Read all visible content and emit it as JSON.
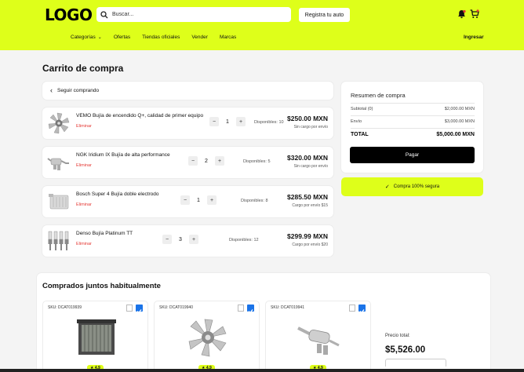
{
  "header": {
    "logo": "LOGO",
    "search_placeholder": "Buscar...",
    "register_label": "Registra tu auto",
    "login_label": "Ingresar",
    "nav": [
      "Categorías",
      "Ofertas",
      "Tiendas oficiales",
      "Vender",
      "Marcas"
    ],
    "accent": "#deff1a"
  },
  "cart": {
    "title": "Carrito de compra",
    "back_label": "Seguir comprando",
    "remove_label": "Eliminar",
    "items": [
      {
        "name": "VEMO Bujía de encendido Q+, calidad de primer equipo",
        "qty": "1",
        "stock": "Disponibles: 10",
        "price": "$250.00 MXN",
        "shipping": "Sin cargo por envío",
        "icon": "fan-part-icon"
      },
      {
        "name": "NGK Iridium IX Bujía de alta performance",
        "qty": "2",
        "stock": "Disponibles: 5",
        "price": "$320.00 MXN",
        "shipping": "Sin cargo por envío",
        "icon": "exhaust-part-icon"
      },
      {
        "name": "Bosch Super 4 Bujía doble electrodo",
        "qty": "1",
        "stock": "Disponibles: 8",
        "price": "$285.50 MXN",
        "shipping": "Cargo por envío $15",
        "icon": "radiator-part-icon"
      },
      {
        "name": "Denso Bujía Platinum TT",
        "qty": "3",
        "stock": "Disponibles: 12",
        "price": "$299.99 MXN",
        "shipping": "Cargo por envío $20",
        "icon": "spark-plugs-icon"
      }
    ]
  },
  "summary": {
    "title": "Resumen de compra",
    "subtotal_label": "Subtotal (0)",
    "subtotal_value": "$2,000.00 MXN",
    "shipping_label": "Envío",
    "shipping_value": "$3,000.00 MXN",
    "total_label": "TOTAL",
    "total_value": "$5,000.00 MXN",
    "pay_label": "Pagar",
    "secure_label": "Compra 100% segura"
  },
  "frequent": {
    "title": "Comprados juntos habitualmente",
    "products": [
      {
        "sku": "SKU: DCAT019939",
        "rating": "4.9",
        "icon": "radiator-icon"
      },
      {
        "sku": "SKU: DCAT019940",
        "rating": "4.9",
        "icon": "fan-icon"
      },
      {
        "sku": "SKU: DCAT019941",
        "rating": "4.9",
        "icon": "exhaust-icon"
      }
    ],
    "total_label": "Precio total:",
    "total_value": "$5,526.00"
  }
}
